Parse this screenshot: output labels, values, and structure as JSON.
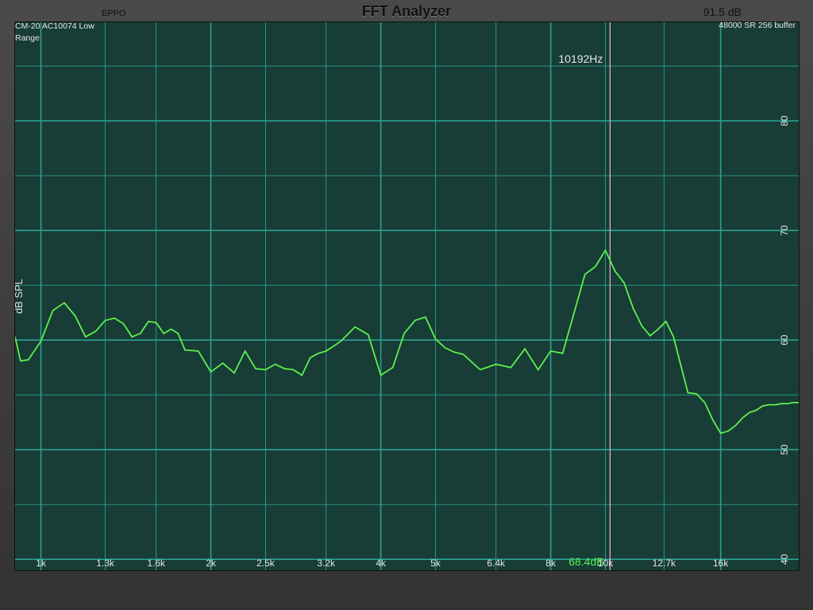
{
  "app": {
    "logo": "EPPO",
    "title": "FFT Analyzer",
    "peak_level": "91.5 dB"
  },
  "info": {
    "mic_line": "CM-20 AC10074 Low Range",
    "sample_info": "48000 SR 256 buffer"
  },
  "cursor": {
    "frequency_label": "10192Hz",
    "level_label": "68.4dB",
    "frequency_hz": 10192,
    "level_db": 68.4
  },
  "colors": {
    "plot_bg": "#183c36",
    "grid": "#2aa290",
    "trace": "#5cf04e",
    "cursor": "#f0b4c8",
    "axis_text": "#e6e6e6",
    "cursor_level_text": "#5cf04e"
  },
  "chart_data": {
    "type": "line",
    "title": "FFT Analyzer",
    "ylabel": "dB SPL",
    "xlabel": "",
    "x_scale": "log",
    "xlim": [
      900,
      22000
    ],
    "ylim": [
      39,
      89
    ],
    "x_ticks": [
      1000,
      1300,
      1600,
      2000,
      2500,
      3200,
      4000,
      5000,
      6400,
      8000,
      10000,
      12700,
      16000
    ],
    "x_tick_labels": [
      "1k",
      "1.3k",
      "1.6k",
      "2k",
      "2.5k",
      "3.2k",
      "4k",
      "5k",
      "6.4k",
      "8k",
      "10k",
      "12.7k",
      "16k"
    ],
    "y_ticks": [
      40,
      50,
      60,
      70,
      80
    ],
    "y_tick_labels": [
      "40",
      "50",
      "60",
      "70",
      "80"
    ],
    "grid": true,
    "series": [
      {
        "x": [
          900,
          920,
          950,
          1000,
          1050,
          1100,
          1150,
          1200,
          1250,
          1300,
          1350,
          1400,
          1450,
          1500,
          1550,
          1600,
          1650,
          1700,
          1750,
          1800,
          1900,
          2000,
          2100,
          2200,
          2300,
          2400,
          2500,
          2600,
          2700,
          2800,
          2900,
          3000,
          3100,
          3200,
          3400,
          3600,
          3800,
          4000,
          4200,
          4400,
          4600,
          4800,
          5000,
          5200,
          5400,
          5600,
          6000,
          6400,
          6800,
          7200,
          7600,
          8000,
          8400,
          8800,
          9200,
          9600,
          10000,
          10400,
          10800,
          11200,
          11600,
          12000,
          12400,
          12800,
          13200,
          13600,
          14000,
          14500,
          15000,
          15500,
          16000,
          16500,
          17000,
          17500,
          18000,
          18500,
          19000,
          19500,
          20000,
          20500,
          21000,
          21500,
          22000
        ],
        "y": [
          60.3,
          58.1,
          58.2,
          59.9,
          62.7,
          63.4,
          62.2,
          60.3,
          60.8,
          61.8,
          62.0,
          61.5,
          60.3,
          60.6,
          61.7,
          61.6,
          60.6,
          61.0,
          60.6,
          59.1,
          59.0,
          57.1,
          57.9,
          57.0,
          59.0,
          57.4,
          57.3,
          57.8,
          57.4,
          57.3,
          56.8,
          58.4,
          58.8,
          59.0,
          59.9,
          61.2,
          60.5,
          56.8,
          57.5,
          60.6,
          61.8,
          62.1,
          60.1,
          59.3,
          58.9,
          58.7,
          57.3,
          57.8,
          57.5,
          59.2,
          57.3,
          59.0,
          58.8,
          62.5,
          66.0,
          66.7,
          68.2,
          66.3,
          65.2,
          62.9,
          61.3,
          60.4,
          61.0,
          61.7,
          60.3,
          57.7,
          55.2,
          55.1,
          54.3,
          52.7,
          51.5,
          51.7,
          52.2,
          52.9,
          53.4,
          53.6,
          54.0,
          54.1,
          54.1,
          54.2,
          54.2,
          54.3,
          54.3
        ]
      }
    ]
  }
}
